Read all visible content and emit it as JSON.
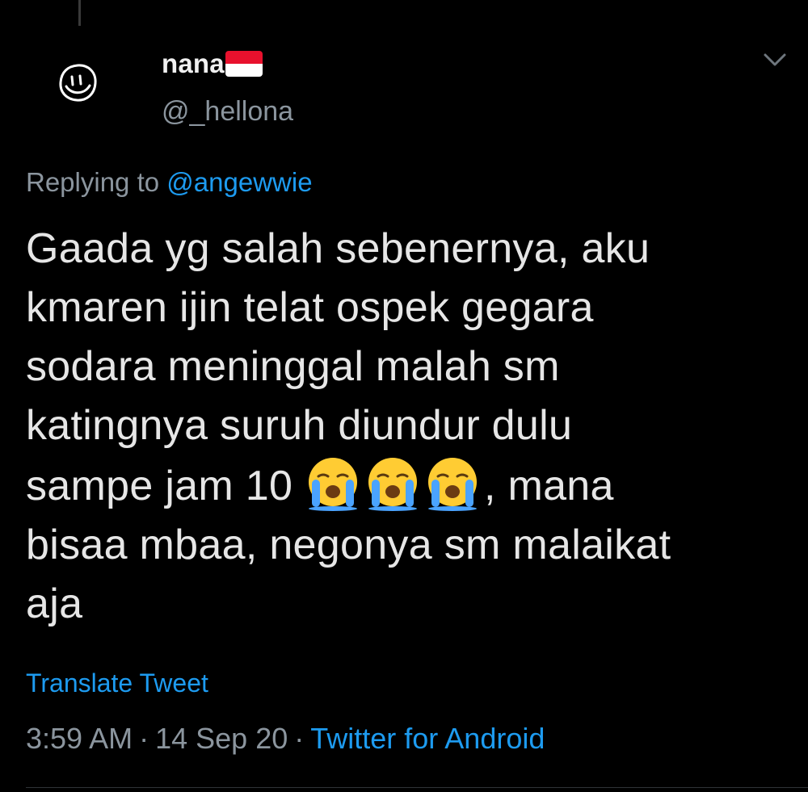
{
  "tweet": {
    "display_name": "nana",
    "flag_icon": "indonesia-flag-icon",
    "username": "@_hellona",
    "reply_prefix": "Replying to",
    "reply_to": "@angewwie",
    "body_lines": {
      "l1": "Gaada yg salah sebenernya, aku",
      "l2": "kmaren ijin telat ospek gegara",
      "l3": "sodara meninggal malah sm",
      "l4": "katingnya suruh diundur dulu",
      "l5a": "sampe jam 10 ",
      "emoji": "loudly-crying-face",
      "l5b": ", mana",
      "l6": "bisaa mbaa, negonya sm malaikat",
      "l7": "aja"
    },
    "translate_label": "Translate Tweet",
    "time": "3:59 AM",
    "date": "14 Sep 20",
    "source": "Twitter for Android",
    "separator": "·"
  },
  "colors": {
    "background": "#000000",
    "link_blue": "#1d9bf0",
    "muted_gray": "#8b959e",
    "flag_red": "#e8112d",
    "flag_white": "#ffffff"
  }
}
